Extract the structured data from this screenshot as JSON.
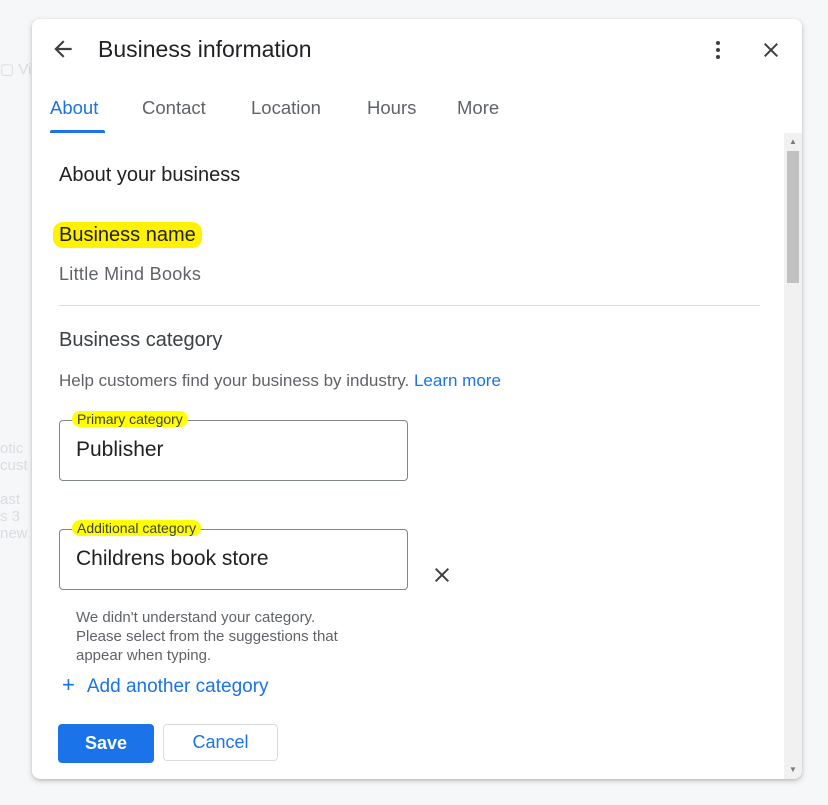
{
  "dialog": {
    "title": "Business information",
    "tabs": [
      {
        "label": "About",
        "active": true
      },
      {
        "label": "Contact",
        "active": false
      },
      {
        "label": "Location",
        "active": false
      },
      {
        "label": "Hours",
        "active": false
      },
      {
        "label": "More",
        "active": false
      }
    ]
  },
  "about": {
    "section_title": "About your business",
    "business_name": {
      "label": "Business name",
      "value": "Little Mind Books"
    },
    "category": {
      "title": "Business category",
      "help": "Help customers find your business by industry.",
      "learn_more": "Learn more",
      "primary": {
        "label": "Primary category",
        "value": "Publisher"
      },
      "additional": {
        "label": "Additional category",
        "value": "Childrens book store",
        "error_lines": [
          "We didn't understand your category.",
          "Please select from the suggestions that",
          "appear when typing."
        ]
      },
      "add_another": "Add another category"
    }
  },
  "actions": {
    "save": "Save",
    "cancel": "Cancel"
  },
  "colors": {
    "accent": "#1a73e8",
    "highlight": "#fff200"
  }
}
